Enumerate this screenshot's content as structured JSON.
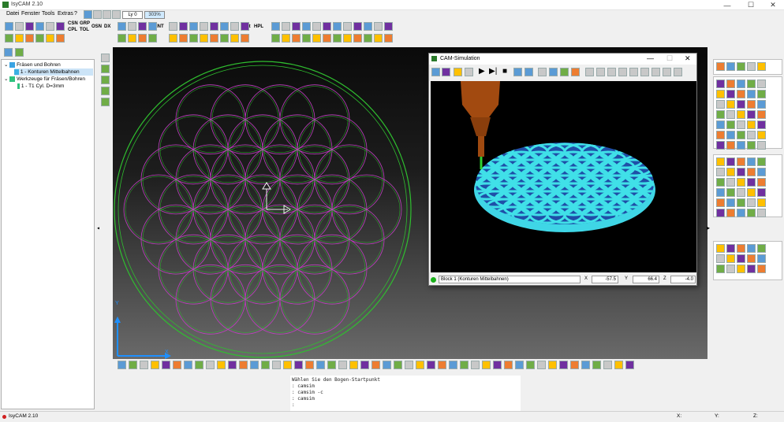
{
  "window": {
    "title": "IsyCAM 2.10",
    "controls": [
      "—",
      "☐",
      "✕"
    ]
  },
  "menu": [
    "Datei",
    "Fenster",
    "Tools",
    "Extras",
    "?"
  ],
  "toolbar": {
    "layer": "Ly 0",
    "zoom": "303%",
    "labels": [
      "CSN",
      "GRP",
      "CPL",
      "TOL",
      "OSN",
      "DX",
      "INT",
      "Dst",
      "HPL"
    ]
  },
  "tree": {
    "items": [
      {
        "label": "Fräsen und Bohren",
        "level": 0
      },
      {
        "label": "1 - Konturen Mittelbahnen",
        "level": 1,
        "selected": true
      },
      {
        "label": "Werkzeuge für Fräsen/Bohren",
        "level": 0
      },
      {
        "label": "1 - T1 Cyl. D=3mm",
        "level": 1
      }
    ]
  },
  "axes": {
    "y": "Y",
    "x": "X"
  },
  "camsim": {
    "title": "CAM-Simulation",
    "status": "Block 1 (Konturen Mittelbahnen)",
    "x_label": "X",
    "x_value": "-57.5",
    "y_label": "Y",
    "y_value": "66.4",
    "z_label": "Z",
    "z_value": "-4.0"
  },
  "console": {
    "lines": [
      "Wählen Sie den Bogen-Startpunkt",
      ": camsim",
      ": camsim -c",
      ": camsim",
      ":"
    ]
  },
  "statusbar": {
    "app": "IsyCAM 2.10",
    "x": "X:",
    "y": "Y:",
    "z": "Z:"
  },
  "colors": {
    "circle": "#2fbf2f",
    "pattern": "#c040c0",
    "accent": "#1e90ff"
  }
}
